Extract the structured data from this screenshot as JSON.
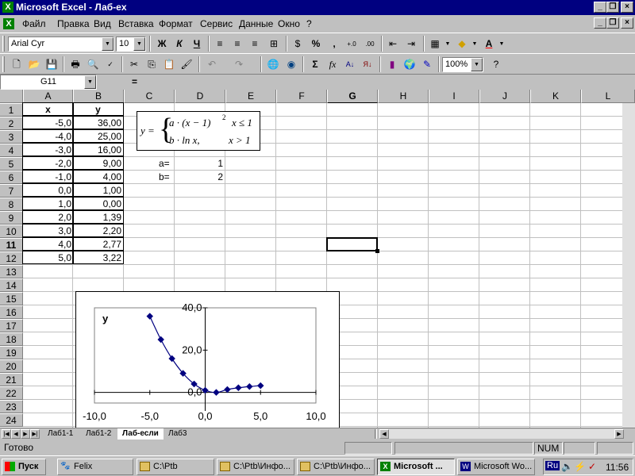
{
  "titlebar": {
    "title": "Microsoft Excel - Лаб-ex"
  },
  "menu": [
    "Файл",
    "Правка",
    "Вид",
    "Вставка",
    "Формат",
    "Сервис",
    "Данные",
    "Окно",
    "?"
  ],
  "format_toolbar": {
    "font": "Arial Cyr",
    "size": "10",
    "bold": "Ж",
    "italic": "К",
    "underline": "Ч",
    "percent": "%",
    "comma": ","
  },
  "standard_toolbar": {
    "zoom": "100%",
    "sum": "Σ",
    "fx": "fx"
  },
  "formula_bar": {
    "name_box": "G11",
    "equals": "=",
    "content": ""
  },
  "grid": {
    "columns": [
      "A",
      "B",
      "C",
      "D",
      "E",
      "F",
      "G",
      "H",
      "I",
      "J",
      "K",
      "L"
    ],
    "rows": [
      "1",
      "2",
      "3",
      "4",
      "5",
      "6",
      "7",
      "8",
      "9",
      "10",
      "11",
      "12",
      "13",
      "14",
      "15",
      "16",
      "17",
      "18",
      "19",
      "20",
      "21",
      "22",
      "23",
      "24"
    ],
    "header_x": "x",
    "header_y": "y",
    "x_values": [
      "-5,0",
      "-4,0",
      "-3,0",
      "-2,0",
      "-1,0",
      "0,0",
      "1,0",
      "2,0",
      "3,0",
      "4,0",
      "5,0"
    ],
    "y_values": [
      "36,00",
      "25,00",
      "16,00",
      "9,00",
      "4,00",
      "1,00",
      "0,00",
      "1,39",
      "2,20",
      "2,77",
      "3,22"
    ],
    "a_label": "a=",
    "a_value": "1",
    "b_label": "b=",
    "b_value": "2",
    "selected_cell": "G11"
  },
  "formula_box": {
    "lhs": "y =",
    "case1": "a · (x − 1)",
    "case1_exp": "2",
    "case1_cond": "x ≤ 1",
    "case2": "b · ln x,",
    "case2_cond": "x > 1"
  },
  "chart_data": {
    "type": "scatter",
    "x": [
      -5,
      -4,
      -3,
      -2,
      -1,
      0,
      1,
      2,
      3,
      4,
      5
    ],
    "y": [
      36,
      25,
      16,
      9,
      4,
      1,
      0,
      1.39,
      2.2,
      2.77,
      3.22
    ],
    "ylabel": "y",
    "xlabel": "",
    "xlim": [
      -10,
      10
    ],
    "ylim": [
      -5,
      40
    ],
    "x_ticks": [
      "-10,0",
      "-5,0",
      "0,0",
      "5,0",
      "10,0"
    ],
    "y_ticks": [
      "0,0",
      "20,0",
      "40,0"
    ],
    "marker_color": "#000080",
    "line": "smooth"
  },
  "sheet_tabs": [
    "Лаб1-1",
    "Лаб1-2",
    "Лаб-если",
    "Лаб3"
  ],
  "active_tab": "Лаб-если",
  "status": {
    "text": "Готово",
    "num": "NUM"
  },
  "taskbar": {
    "start": "Пуск",
    "tasks": [
      "Felix",
      "C:\\Ptb",
      "C:\\Ptb\\Инфо...",
      "C:\\Ptb\\Инфо...",
      "Microsoft ...",
      "Microsoft Wo..."
    ],
    "active_task": "Microsoft ...",
    "lang": "Ru",
    "clock": "11:56"
  }
}
